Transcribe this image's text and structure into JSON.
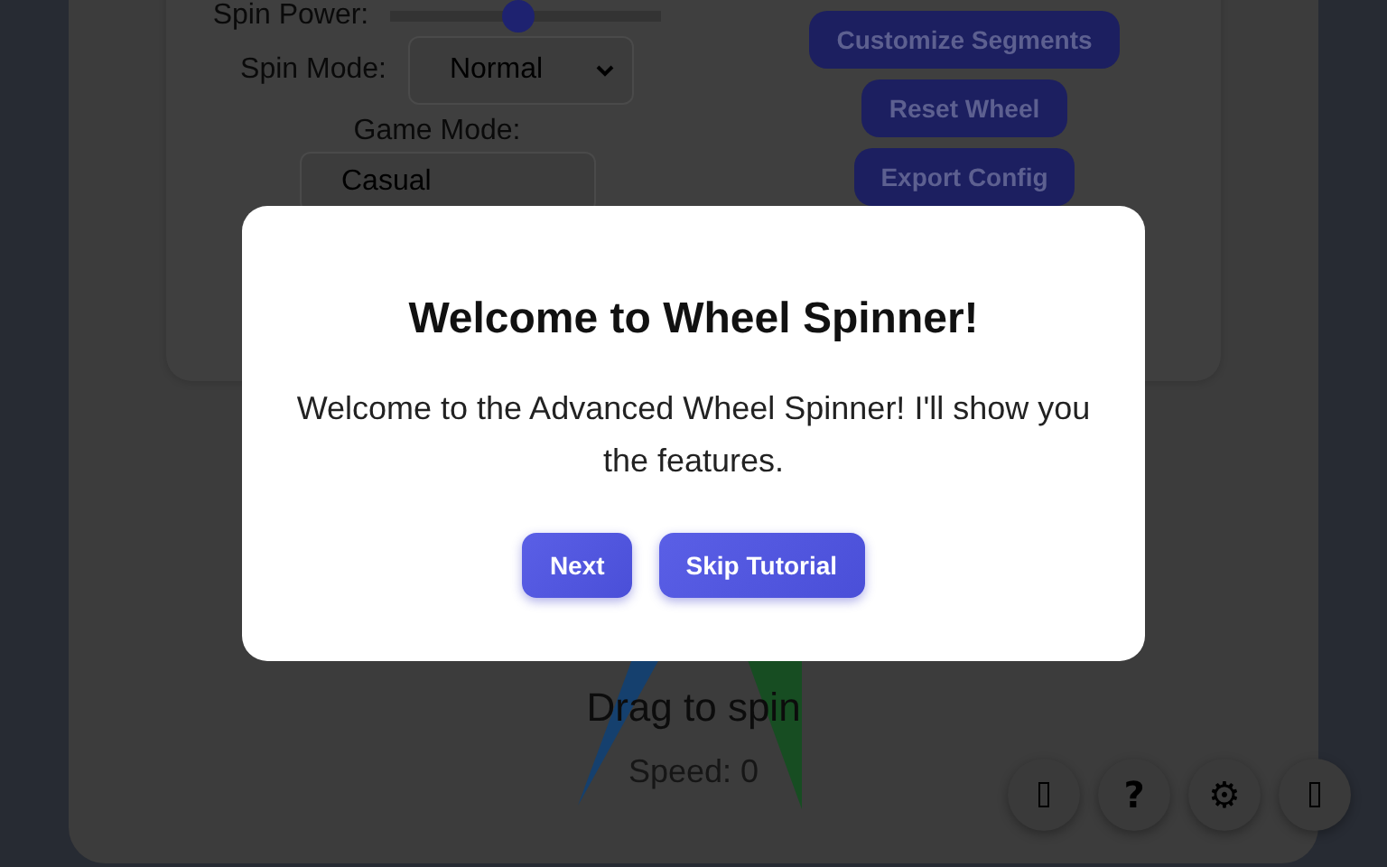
{
  "controls": {
    "spin_power": {
      "label": "Spin Power:",
      "level": 0.47
    },
    "spin_mode": {
      "label": "Spin Mode:",
      "value": "Normal"
    },
    "game_mode": {
      "label": "Game Mode:",
      "value": "Casual"
    }
  },
  "actions": [
    "Customize Segments",
    "Reset Wheel",
    "Export Config"
  ],
  "wheel": {
    "hint": "Drag to spin",
    "speed": "Speed: 0"
  },
  "fab": [
    {
      "kind": "missing-glyph"
    },
    {
      "kind": "text",
      "label": "?"
    },
    {
      "kind": "text",
      "label": "⚙"
    },
    {
      "kind": "missing-glyph"
    }
  ],
  "dialog": {
    "title": "Welcome to Wheel Spinner!",
    "text": "Welcome to the Advanced Wheel Spinner! I'll show you the features.",
    "buttons": [
      "Next",
      "Skip Tutorial"
    ]
  }
}
